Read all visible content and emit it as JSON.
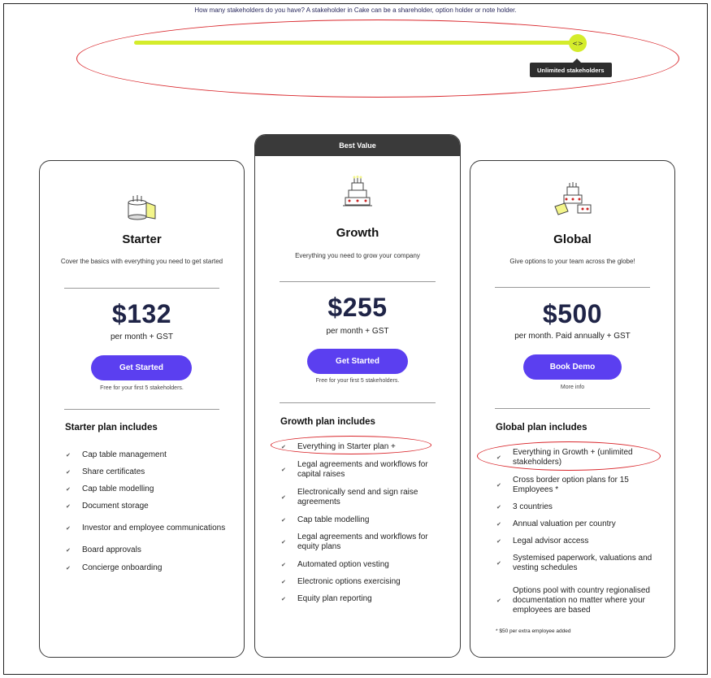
{
  "slider": {
    "question": "How many stakeholders do you have? A stakeholder in Cake can be a shareholder, option holder or note holder.",
    "thumb_glyph": "<>",
    "value_fraction": 1.0,
    "tooltip": "Unlimited stakeholders",
    "accent_color": "#d4ec2b"
  },
  "annotation_color": "#d9262b",
  "brand_color": "#5b3ff0",
  "plans": {
    "starter": {
      "name": "Starter",
      "description": "Cover the basics with everything you need to get started",
      "price": "$132",
      "price_sub": "per month + GST",
      "cta": "Get Started",
      "cta_note": "Free for your first 5 stakeholders.",
      "includes_title": "Starter plan includes",
      "features": [
        "Cap table management",
        "Share certificates",
        "Cap table modelling",
        "Document storage",
        "Investor and employee communications",
        "Board approvals",
        "Concierge onboarding"
      ]
    },
    "growth": {
      "badge": "Best Value",
      "name": "Growth",
      "description": "Everything you need to grow your company",
      "price": "$255",
      "price_sub": "per month + GST",
      "cta": "Get Started",
      "cta_note": "Free for your first 5 stakeholders.",
      "includes_title": "Growth plan includes",
      "features": [
        "Everything in Starter plan +",
        "Legal agreements and workflows for capital raises",
        "Electronically send and sign raise agreements",
        "Cap table modelling",
        "Legal agreements and workflows for equity plans",
        "Automated option vesting",
        "Electronic options exercising",
        "Equity plan reporting"
      ]
    },
    "global": {
      "name": "Global",
      "description": "Give options to your team across the globe!",
      "price": "$500",
      "price_sub": "per month. Paid annually + GST",
      "cta": "Book Demo",
      "cta_note": "More info",
      "includes_title": "Global plan includes",
      "features": [
        "Everything in Growth + (unlimited stakeholders)",
        "Cross border option plans for 15 Employees *",
        "3 countries",
        "Annual valuation per country",
        "Legal advisor access",
        "Systemised paperwork, valuations and vesting schedules",
        "Options pool with country regionalised documentation no matter where your employees are based"
      ],
      "footnote": "* $50 per extra employee added"
    }
  },
  "icons": {
    "check": "check-icon",
    "starter_cake": "small-cake-icon",
    "growth_cake": "tiered-cake-icon",
    "global_cake": "multiple-cakes-icon"
  }
}
